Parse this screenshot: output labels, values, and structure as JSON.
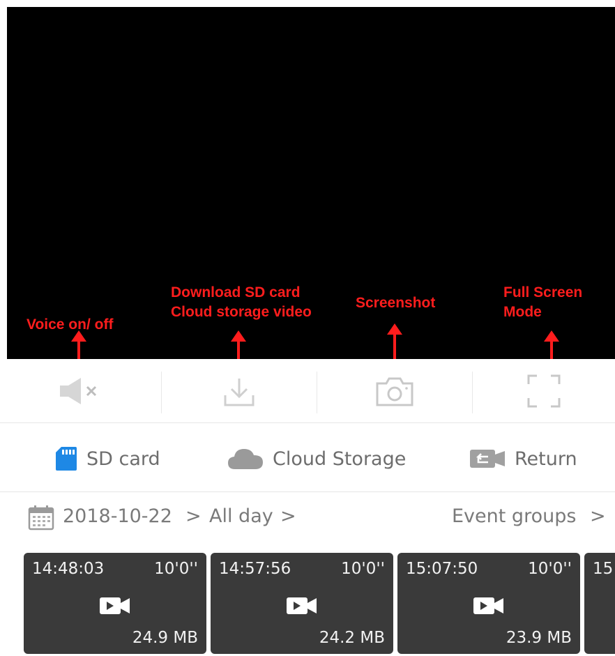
{
  "annotations": {
    "voice": "Voice on/ off",
    "download_line1": "Download SD card",
    "download_line2": "Cloud storage video",
    "screenshot": "Screenshot",
    "fullscreen_line1": "Full Screen",
    "fullscreen_line2": "Mode"
  },
  "controls": [
    {
      "icon": "speaker-muted-icon"
    },
    {
      "icon": "download-icon"
    },
    {
      "icon": "camera-icon"
    },
    {
      "icon": "fullscreen-icon"
    }
  ],
  "sources": {
    "sd_card": "SD card",
    "cloud_storage": "Cloud Storage",
    "return": "Return"
  },
  "datebar": {
    "date": "2018-10-22",
    "sep1": ">",
    "range": "All day",
    "sep2": ">",
    "groups": "Event groups",
    "sep3": ">"
  },
  "clips": [
    {
      "time": "14:48:03",
      "duration": "10'0''",
      "size": "24.9 MB"
    },
    {
      "time": "14:57:56",
      "duration": "10'0''",
      "size": "24.2 MB"
    },
    {
      "time": "15:07:50",
      "duration": "10'0''",
      "size": "23.9 MB"
    },
    {
      "time": "15",
      "duration": "",
      "size": ""
    }
  ],
  "colors": {
    "annotation": "#ff1d1d",
    "sd_icon": "#1e88e5",
    "card_bg": "#3a3a3a"
  }
}
